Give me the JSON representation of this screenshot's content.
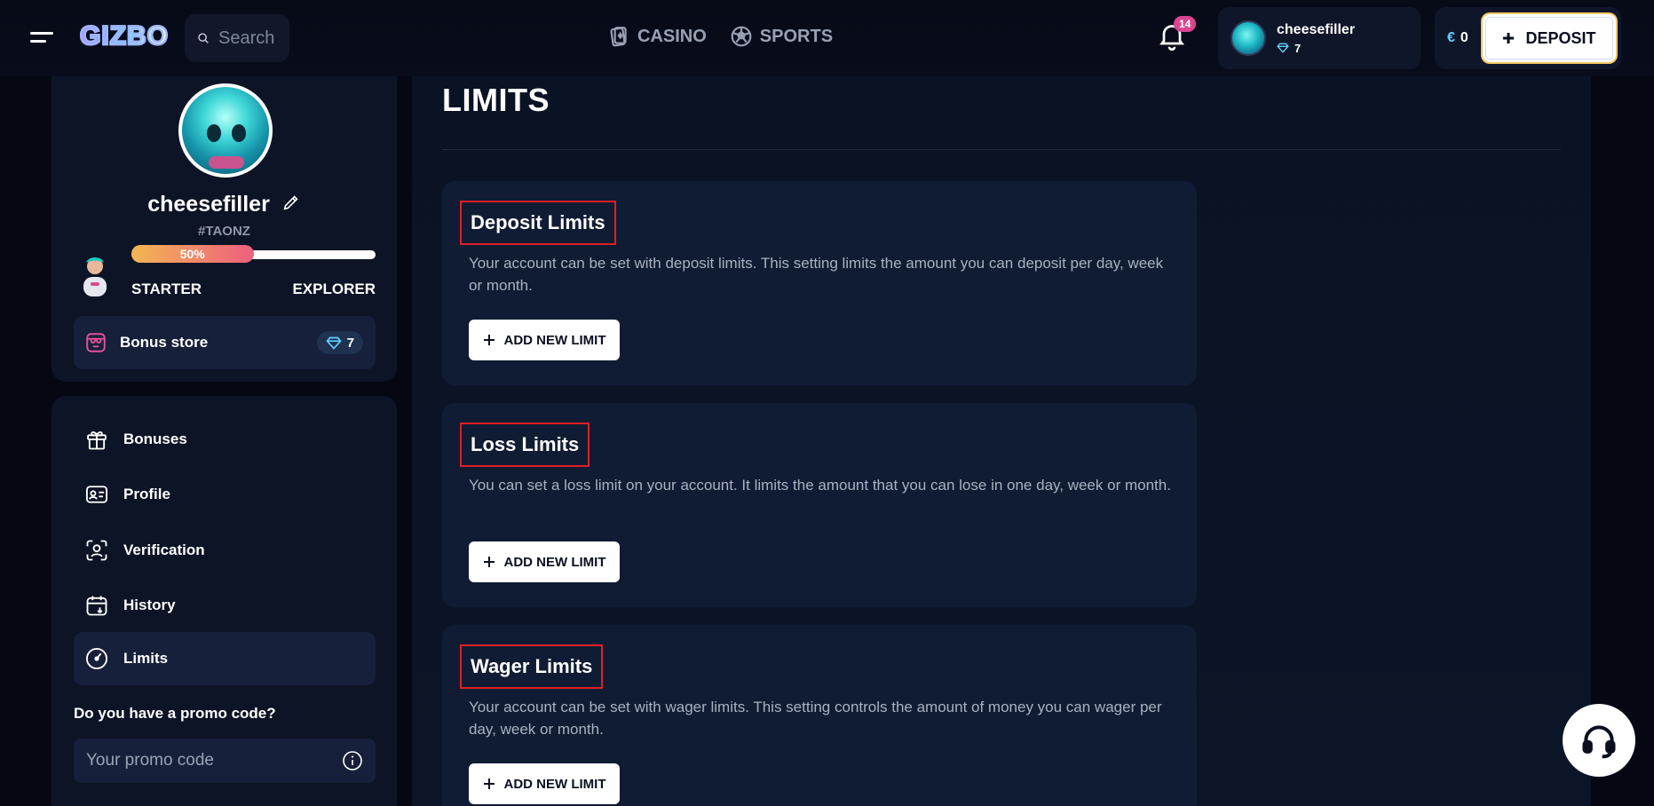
{
  "header": {
    "logo": "GIZBO",
    "search_placeholder": "Search",
    "nav": [
      {
        "label": "CASINO",
        "icon": "cards-icon"
      },
      {
        "label": "SPORTS",
        "icon": "soccer-ball-icon"
      }
    ],
    "notifications_count": "14",
    "user": {
      "name": "cheesefiller",
      "gems": "7"
    },
    "balance": {
      "currency": "€",
      "amount": "0"
    },
    "deposit_label": "DEPOSIT"
  },
  "profile": {
    "name": "cheesefiller",
    "tag": "#TAONZ",
    "progress_text": "50%",
    "progress_value": 0.5,
    "level_from": "STARTER",
    "level_to": "EXPLORER",
    "bonus_store_label": "Bonus store",
    "bonus_store_gems": "7"
  },
  "menu": {
    "items": [
      {
        "label": "Bonuses",
        "icon": "gift-icon"
      },
      {
        "label": "Profile",
        "icon": "id-card-icon"
      },
      {
        "label": "Verification",
        "icon": "face-scan-icon"
      },
      {
        "label": "History",
        "icon": "calendar-history-icon"
      },
      {
        "label": "Limits",
        "icon": "gauge-icon",
        "active": true
      }
    ],
    "promo_title": "Do you have a promo code?",
    "promo_placeholder": "Your promo code"
  },
  "main": {
    "title": "LIMITS",
    "cards": [
      {
        "title": "Deposit Limits",
        "description": "Your account can be set with deposit limits. This setting limits the amount you can deposit per day, week or month.",
        "button": "ADD NEW LIMIT"
      },
      {
        "title": "Loss Limits",
        "description": "You can set a loss limit on your account. It limits the amount that you can lose in one day, week or month.",
        "button": "ADD NEW LIMIT"
      },
      {
        "title": "Wager Limits",
        "description": "Your account can be set with wager limits. This setting controls the amount of money you can wager per day, week or month.",
        "button": "ADD NEW LIMIT"
      }
    ]
  },
  "colors": {
    "accent_gem": "#64d0ff",
    "notification_badge": "#d9458f",
    "highlight_border": "#e01f26",
    "progress_start": "#f4b653",
    "progress_end": "#ec5f7d"
  }
}
